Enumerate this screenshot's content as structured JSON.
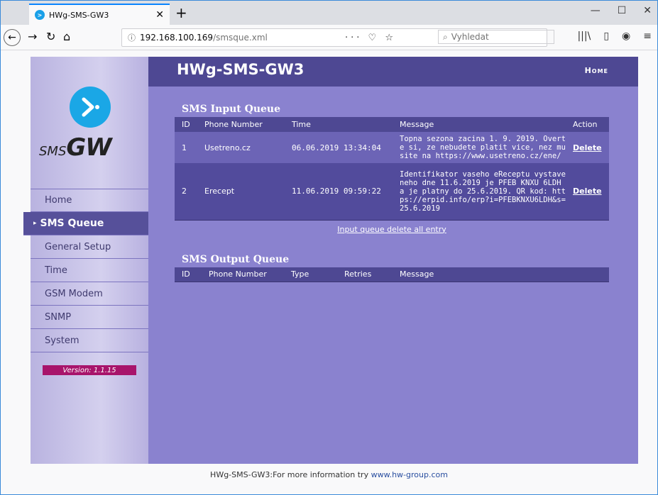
{
  "browser": {
    "tab_title": "HWg-SMS-GW3",
    "url_host": "192.168.100.169",
    "url_path": "/smsque.xml",
    "search_placeholder": "Vyhledat"
  },
  "header": {
    "title": "HWg-SMS-GW3",
    "home_label": "Home"
  },
  "logo": {
    "sms": "SMS",
    "gw": "GW"
  },
  "menu": {
    "items": [
      {
        "label": "Home"
      },
      {
        "label": "SMS Queue",
        "active": true
      },
      {
        "label": "General Setup"
      },
      {
        "label": "Time"
      },
      {
        "label": "GSM Modem"
      },
      {
        "label": "SNMP"
      },
      {
        "label": "System"
      }
    ]
  },
  "version": "Version: 1.1.15",
  "input_queue": {
    "title": "SMS Input Queue",
    "columns": [
      "ID",
      "Phone Number",
      "Time",
      "Message",
      "Action"
    ],
    "rows": [
      {
        "id": "1",
        "phone": "Usetreno.cz",
        "time": "06.06.2019 13:34:04",
        "message": "Topna sezona zacina 1. 9. 2019. Overte si, ze nebudete platit vice, nez musite na https://www.usetreno.cz/ene/",
        "action": "Delete"
      },
      {
        "id": "2",
        "phone": "Erecept",
        "time": "11.06.2019 09:59:22",
        "message": "Identifikator vaseho eReceptu vystaveneho dne 11.6.2019 je PFEB KNXU 6LDH a je platny do 25.6.2019. QR kod: https://erpid.info/erp?i=PFEBKNXU6LDH&s=25.6.2019",
        "action": "Delete"
      }
    ],
    "delete_all": "Input queue delete all entry"
  },
  "output_queue": {
    "title": "SMS Output Queue",
    "columns": [
      "ID",
      "Phone Number",
      "Type",
      "Retries",
      "Message"
    ]
  },
  "footer": {
    "text": "HWg-SMS-GW3:For more information try ",
    "link": "www.hw-group.com"
  },
  "colors": {
    "page_bg": "#8a82cf",
    "header_bg": "#4e4893",
    "version_bg": "#a8146b",
    "logo_blue": "#1aa7e6"
  }
}
